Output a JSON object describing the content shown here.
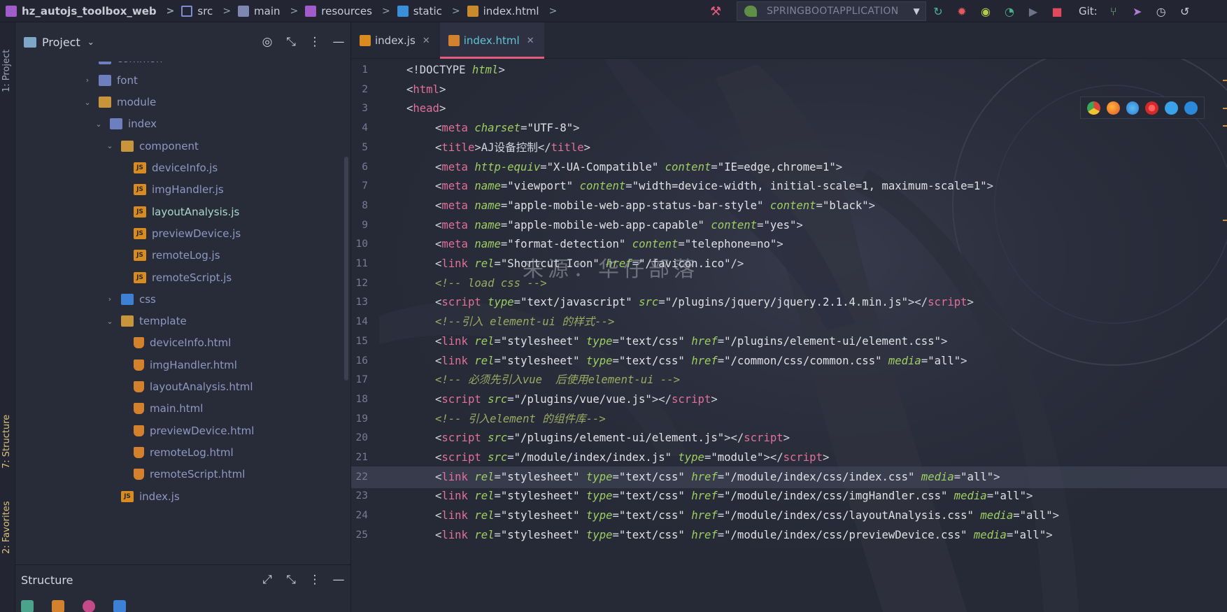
{
  "breadcrumb": [
    {
      "label": "hz_autojs_toolbox_web",
      "icon": "project-icon"
    },
    {
      "label": "src",
      "icon": "source-folder-icon"
    },
    {
      "label": "main",
      "icon": "folder-icon"
    },
    {
      "label": "resources",
      "icon": "resources-folder-icon"
    },
    {
      "label": "static",
      "icon": "web-folder-icon"
    },
    {
      "label": "index.html",
      "icon": "html-file-icon"
    }
  ],
  "toolbar": {
    "run_config": "SPRINGBOOTAPPLICATION",
    "git_label": "Git:"
  },
  "left_strip": {
    "project_tab": "1: Project",
    "structure_tab": "7: Structure",
    "favorites_tab": "2: Favorites"
  },
  "project_panel": {
    "title": "Project",
    "tree": [
      {
        "label": "common",
        "type": "folder",
        "depth": 0,
        "arrow": "›"
      },
      {
        "label": "font",
        "type": "folder",
        "depth": 0,
        "arrow": "›"
      },
      {
        "label": "module",
        "type": "package",
        "depth": 0,
        "arrow": "⌄"
      },
      {
        "label": "index",
        "type": "folder",
        "depth": 1,
        "arrow": "⌄"
      },
      {
        "label": "component",
        "type": "package",
        "depth": 2,
        "arrow": "⌄"
      },
      {
        "label": "deviceInfo.js",
        "type": "js",
        "depth": 3
      },
      {
        "label": "imgHandler.js",
        "type": "js",
        "depth": 3
      },
      {
        "label": "layoutAnalysis.js",
        "type": "js",
        "depth": 3,
        "active": true
      },
      {
        "label": "previewDevice.js",
        "type": "js",
        "depth": 3
      },
      {
        "label": "remoteLog.js",
        "type": "js",
        "depth": 3
      },
      {
        "label": "remoteScript.js",
        "type": "js",
        "depth": 3
      },
      {
        "label": "css",
        "type": "css",
        "depth": 2,
        "arrow": "›"
      },
      {
        "label": "template",
        "type": "package",
        "depth": 2,
        "arrow": "⌄"
      },
      {
        "label": "deviceInfo.html",
        "type": "html",
        "depth": 3
      },
      {
        "label": "imgHandler.html",
        "type": "html",
        "depth": 3
      },
      {
        "label": "layoutAnalysis.html",
        "type": "html",
        "depth": 3
      },
      {
        "label": "main.html",
        "type": "html",
        "depth": 3
      },
      {
        "label": "previewDevice.html",
        "type": "html",
        "depth": 3
      },
      {
        "label": "remoteLog.html",
        "type": "html",
        "depth": 3
      },
      {
        "label": "remoteScript.html",
        "type": "html",
        "depth": 3
      },
      {
        "label": "index.js",
        "type": "js",
        "depth": 2
      }
    ]
  },
  "structure_panel": {
    "title": "Structure"
  },
  "editor": {
    "tabs": [
      {
        "label": "index.js",
        "type": "js",
        "active": false
      },
      {
        "label": "index.html",
        "type": "html",
        "active": true
      }
    ],
    "current_line": 22,
    "watermark": "来源：华仔部落",
    "lines": [
      {
        "n": "1",
        "indent": 0,
        "parts": [
          [
            "br",
            "<!"
          ],
          [
            "doc",
            "DOCTYPE "
          ],
          [
            "kw",
            "html"
          ],
          [
            "br",
            ">"
          ]
        ]
      },
      {
        "n": "2",
        "indent": 0,
        "parts": [
          [
            "br",
            "<"
          ],
          [
            "tag",
            "html"
          ],
          [
            "br",
            ">"
          ]
        ]
      },
      {
        "n": "3",
        "indent": 0,
        "parts": [
          [
            "br",
            "<"
          ],
          [
            "tag",
            "head"
          ],
          [
            "br",
            ">"
          ]
        ]
      },
      {
        "n": "4",
        "indent": 1,
        "parts": [
          [
            "br",
            "<"
          ],
          [
            "tag",
            "meta "
          ],
          [
            "attr",
            "charset"
          ],
          [
            "br",
            "="
          ],
          [
            "str",
            "\"UTF-8\""
          ],
          [
            "br",
            ">"
          ]
        ]
      },
      {
        "n": "5",
        "indent": 1,
        "parts": [
          [
            "br",
            "<"
          ],
          [
            "tag",
            "title"
          ],
          [
            "br",
            ">AJ设备控制</"
          ],
          [
            "tag",
            "title"
          ],
          [
            "br",
            ">"
          ]
        ]
      },
      {
        "n": "6",
        "indent": 1,
        "parts": [
          [
            "br",
            "<"
          ],
          [
            "tag",
            "meta "
          ],
          [
            "attr",
            "http-equiv"
          ],
          [
            "br",
            "="
          ],
          [
            "str",
            "\"X-UA-Compatible\" "
          ],
          [
            "attr",
            "content"
          ],
          [
            "br",
            "="
          ],
          [
            "str",
            "\"IE=edge,chrome=1\""
          ],
          [
            "br",
            ">"
          ]
        ]
      },
      {
        "n": "7",
        "indent": 1,
        "parts": [
          [
            "br",
            "<"
          ],
          [
            "tag",
            "meta "
          ],
          [
            "attr",
            "name"
          ],
          [
            "br",
            "="
          ],
          [
            "str",
            "\"viewport\" "
          ],
          [
            "attr",
            "content"
          ],
          [
            "br",
            "="
          ],
          [
            "str",
            "\"width=device-width, initial-scale=1, maximum-scale=1\""
          ],
          [
            "br",
            ">"
          ]
        ]
      },
      {
        "n": "8",
        "indent": 1,
        "parts": [
          [
            "br",
            "<"
          ],
          [
            "tag",
            "meta "
          ],
          [
            "attr",
            "name"
          ],
          [
            "br",
            "="
          ],
          [
            "str",
            "\"apple-mobile-web-app-status-bar-style\" "
          ],
          [
            "attr",
            "content"
          ],
          [
            "br",
            "="
          ],
          [
            "str",
            "\"black\""
          ],
          [
            "br",
            ">"
          ]
        ]
      },
      {
        "n": "9",
        "indent": 1,
        "parts": [
          [
            "br",
            "<"
          ],
          [
            "tag",
            "meta "
          ],
          [
            "attr",
            "name"
          ],
          [
            "br",
            "="
          ],
          [
            "str",
            "\"apple-mobile-web-app-capable\" "
          ],
          [
            "attr",
            "content"
          ],
          [
            "br",
            "="
          ],
          [
            "str",
            "\"yes\""
          ],
          [
            "br",
            ">"
          ]
        ]
      },
      {
        "n": "10",
        "indent": 1,
        "parts": [
          [
            "br",
            "<"
          ],
          [
            "tag",
            "meta "
          ],
          [
            "attr",
            "name"
          ],
          [
            "br",
            "="
          ],
          [
            "str",
            "\"format-detection\" "
          ],
          [
            "attr",
            "content"
          ],
          [
            "br",
            "="
          ],
          [
            "str",
            "\"telephone=no\""
          ],
          [
            "br",
            ">"
          ]
        ]
      },
      {
        "n": "11",
        "indent": 1,
        "parts": [
          [
            "br",
            "<"
          ],
          [
            "tag",
            "link "
          ],
          [
            "attr",
            "rel"
          ],
          [
            "br",
            "="
          ],
          [
            "str",
            "\"Shortcut Icon\" "
          ],
          [
            "attr",
            "href"
          ],
          [
            "br",
            "="
          ],
          [
            "str",
            "\"/favicon.ico\""
          ],
          [
            "br",
            "/>"
          ]
        ]
      },
      {
        "n": "12",
        "indent": 1,
        "parts": [
          [
            "com",
            "<!-- load css -->"
          ]
        ]
      },
      {
        "n": "13",
        "indent": 1,
        "parts": [
          [
            "br",
            "<"
          ],
          [
            "tag",
            "script "
          ],
          [
            "attr",
            "type"
          ],
          [
            "br",
            "="
          ],
          [
            "str",
            "\"text/javascript\" "
          ],
          [
            "attr",
            "src"
          ],
          [
            "br",
            "="
          ],
          [
            "str",
            "\"/plugins/jquery/jquery.2.1.4.min.js\""
          ],
          [
            "br",
            "></"
          ],
          [
            "tag",
            "script"
          ],
          [
            "br",
            ">"
          ]
        ]
      },
      {
        "n": "14",
        "indent": 1,
        "parts": [
          [
            "com",
            "<!--引入 element-ui 的样式-->"
          ]
        ]
      },
      {
        "n": "15",
        "indent": 1,
        "parts": [
          [
            "br",
            "<"
          ],
          [
            "tag",
            "link "
          ],
          [
            "attr",
            "rel"
          ],
          [
            "br",
            "="
          ],
          [
            "str",
            "\"stylesheet\" "
          ],
          [
            "attr",
            "type"
          ],
          [
            "br",
            "="
          ],
          [
            "str",
            "\"text/css\" "
          ],
          [
            "attr",
            "href"
          ],
          [
            "br",
            "="
          ],
          [
            "str",
            "\"/plugins/element-ui/element.css\""
          ],
          [
            "br",
            ">"
          ]
        ]
      },
      {
        "n": "16",
        "indent": 1,
        "parts": [
          [
            "br",
            "<"
          ],
          [
            "tag",
            "link "
          ],
          [
            "attr",
            "rel"
          ],
          [
            "br",
            "="
          ],
          [
            "str",
            "\"stylesheet\" "
          ],
          [
            "attr",
            "type"
          ],
          [
            "br",
            "="
          ],
          [
            "str",
            "\"text/css\" "
          ],
          [
            "attr",
            "href"
          ],
          [
            "br",
            "="
          ],
          [
            "str",
            "\"/common/css/common.css\" "
          ],
          [
            "attr",
            "media"
          ],
          [
            "br",
            "="
          ],
          [
            "str",
            "\"all\""
          ],
          [
            "br",
            ">"
          ]
        ]
      },
      {
        "n": "17",
        "indent": 1,
        "parts": [
          [
            "com",
            "<!-- 必须先引入vue  后使用element-ui -->"
          ]
        ]
      },
      {
        "n": "18",
        "indent": 1,
        "parts": [
          [
            "br",
            "<"
          ],
          [
            "tag",
            "script "
          ],
          [
            "attr",
            "src"
          ],
          [
            "br",
            "="
          ],
          [
            "str",
            "\"/plugins/vue/vue.js\""
          ],
          [
            "br",
            "></"
          ],
          [
            "tag",
            "script"
          ],
          [
            "br",
            ">"
          ]
        ]
      },
      {
        "n": "19",
        "indent": 1,
        "parts": [
          [
            "com",
            "<!-- 引入element 的组件库-->"
          ]
        ]
      },
      {
        "n": "20",
        "indent": 1,
        "parts": [
          [
            "br",
            "<"
          ],
          [
            "tag",
            "script "
          ],
          [
            "attr",
            "src"
          ],
          [
            "br",
            "="
          ],
          [
            "str",
            "\"/plugins/element-ui/element.js\""
          ],
          [
            "br",
            "></"
          ],
          [
            "tag",
            "script"
          ],
          [
            "br",
            ">"
          ]
        ]
      },
      {
        "n": "21",
        "indent": 1,
        "parts": [
          [
            "br",
            "<"
          ],
          [
            "tag",
            "script "
          ],
          [
            "attr",
            "src"
          ],
          [
            "br",
            "="
          ],
          [
            "str",
            "\"/module/index/index.js\" "
          ],
          [
            "attr",
            "type"
          ],
          [
            "br",
            "="
          ],
          [
            "str",
            "\"module\""
          ],
          [
            "br",
            "></"
          ],
          [
            "tag",
            "script"
          ],
          [
            "br",
            ">"
          ]
        ]
      },
      {
        "n": "22",
        "indent": 1,
        "parts": [
          [
            "br",
            "<"
          ],
          [
            "tag",
            "link "
          ],
          [
            "attr",
            "rel"
          ],
          [
            "br",
            "="
          ],
          [
            "str",
            "\"stylesheet\" "
          ],
          [
            "attr",
            "type"
          ],
          [
            "br",
            "="
          ],
          [
            "str",
            "\"text/css\" "
          ],
          [
            "attr",
            "href"
          ],
          [
            "br",
            "="
          ],
          [
            "str",
            "\"/module/index/css/index.css\" "
          ],
          [
            "attr",
            "media"
          ],
          [
            "br",
            "="
          ],
          [
            "str",
            "\"all\""
          ],
          [
            "br",
            ">"
          ]
        ]
      },
      {
        "n": "23",
        "indent": 1,
        "parts": [
          [
            "br",
            "<"
          ],
          [
            "tag",
            "link "
          ],
          [
            "attr",
            "rel"
          ],
          [
            "br",
            "="
          ],
          [
            "str",
            "\"stylesheet\" "
          ],
          [
            "attr",
            "type"
          ],
          [
            "br",
            "="
          ],
          [
            "str",
            "\"text/css\" "
          ],
          [
            "attr",
            "href"
          ],
          [
            "br",
            "="
          ],
          [
            "str",
            "\"/module/index/css/imgHandler.css\" "
          ],
          [
            "attr",
            "media"
          ],
          [
            "br",
            "="
          ],
          [
            "str",
            "\"all\""
          ],
          [
            "br",
            ">"
          ]
        ]
      },
      {
        "n": "24",
        "indent": 1,
        "parts": [
          [
            "br",
            "<"
          ],
          [
            "tag",
            "link "
          ],
          [
            "attr",
            "rel"
          ],
          [
            "br",
            "="
          ],
          [
            "str",
            "\"stylesheet\" "
          ],
          [
            "attr",
            "type"
          ],
          [
            "br",
            "="
          ],
          [
            "str",
            "\"text/css\" "
          ],
          [
            "attr",
            "href"
          ],
          [
            "br",
            "="
          ],
          [
            "str",
            "\"/module/index/css/layoutAnalysis.css\" "
          ],
          [
            "attr",
            "media"
          ],
          [
            "br",
            "="
          ],
          [
            "str",
            "\"all\""
          ],
          [
            "br",
            ">"
          ]
        ]
      },
      {
        "n": "25",
        "indent": 1,
        "parts": [
          [
            "br",
            "<"
          ],
          [
            "tag",
            "link "
          ],
          [
            "attr",
            "rel"
          ],
          [
            "br",
            "="
          ],
          [
            "str",
            "\"stylesheet\" "
          ],
          [
            "attr",
            "type"
          ],
          [
            "br",
            "="
          ],
          [
            "str",
            "\"text/css\" "
          ],
          [
            "attr",
            "href"
          ],
          [
            "br",
            "="
          ],
          [
            "str",
            "\"/module/index/css/previewDevice.css\" "
          ],
          [
            "attr",
            "media"
          ],
          [
            "br",
            "="
          ],
          [
            "str",
            "\"all\""
          ],
          [
            "br",
            ">"
          ]
        ]
      }
    ]
  },
  "colors": {
    "accent_pink": "#e45b7c",
    "tab_active_text": "#5ec5d5",
    "string_green": "#9ecf62"
  }
}
